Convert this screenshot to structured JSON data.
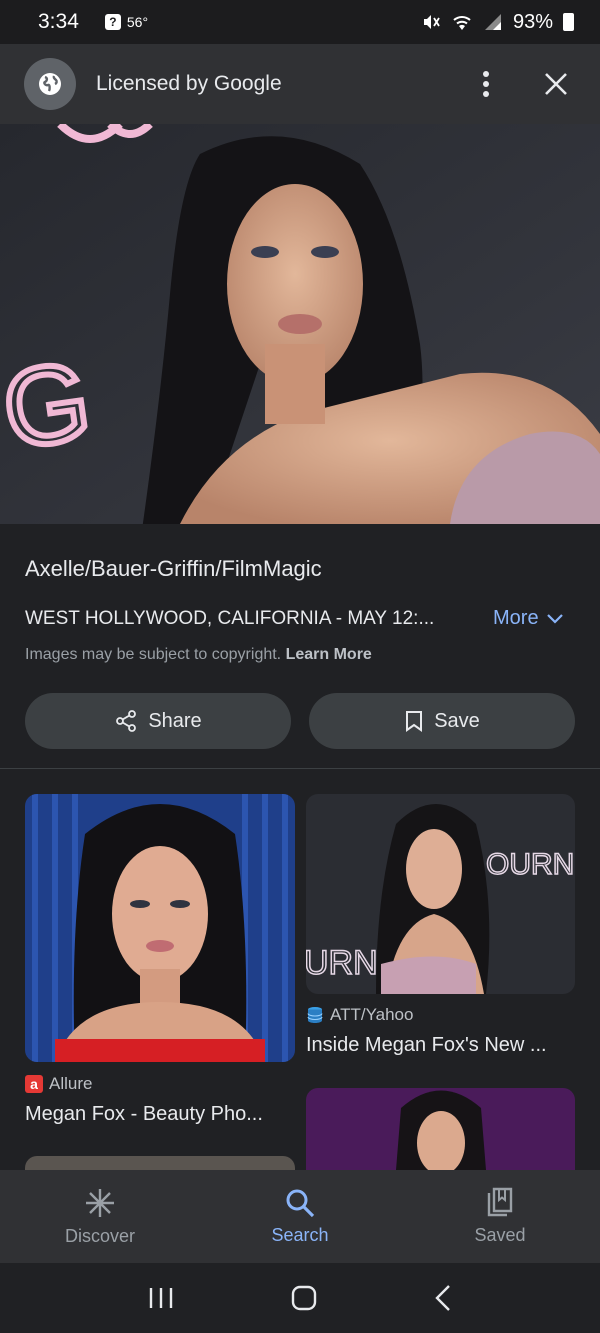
{
  "status_bar": {
    "time": "3:34",
    "weather_badge": "?",
    "temperature": "56°",
    "battery": "93%"
  },
  "header": {
    "title": "Licensed by Google",
    "icons": [
      "globe-icon",
      "more-vert-icon",
      "close-icon"
    ]
  },
  "image_info": {
    "credit": "Axelle/Bauer-Griffin/FilmMagic",
    "caption": "WEST HOLLYWOOD, CALIFORNIA - MAY 12:...",
    "more_label": "More",
    "copyright_text": "Images may be subject to copyright.",
    "learn_more": "Learn More"
  },
  "actions": {
    "share_label": "Share",
    "save_label": "Save"
  },
  "related": [
    {
      "source_badge": "a",
      "source": "Allure",
      "title": "Megan Fox - Beauty Pho..."
    },
    {
      "source": "ATT/Yahoo",
      "title": "Inside Megan Fox's New ..."
    }
  ],
  "hero_backdrop_text": "G",
  "thumb_backdrop_text": [
    "URNIN",
    "OURNIN"
  ],
  "bottom_nav": [
    {
      "label": "Discover",
      "icon": "asterisk-icon",
      "active": false
    },
    {
      "label": "Search",
      "icon": "search-icon",
      "active": true
    },
    {
      "label": "Saved",
      "icon": "collections-bookmark-icon",
      "active": false
    }
  ],
  "colors": {
    "accent": "#8ab4f8",
    "background": "#202124",
    "surface": "#303134",
    "button": "#3c4043"
  }
}
